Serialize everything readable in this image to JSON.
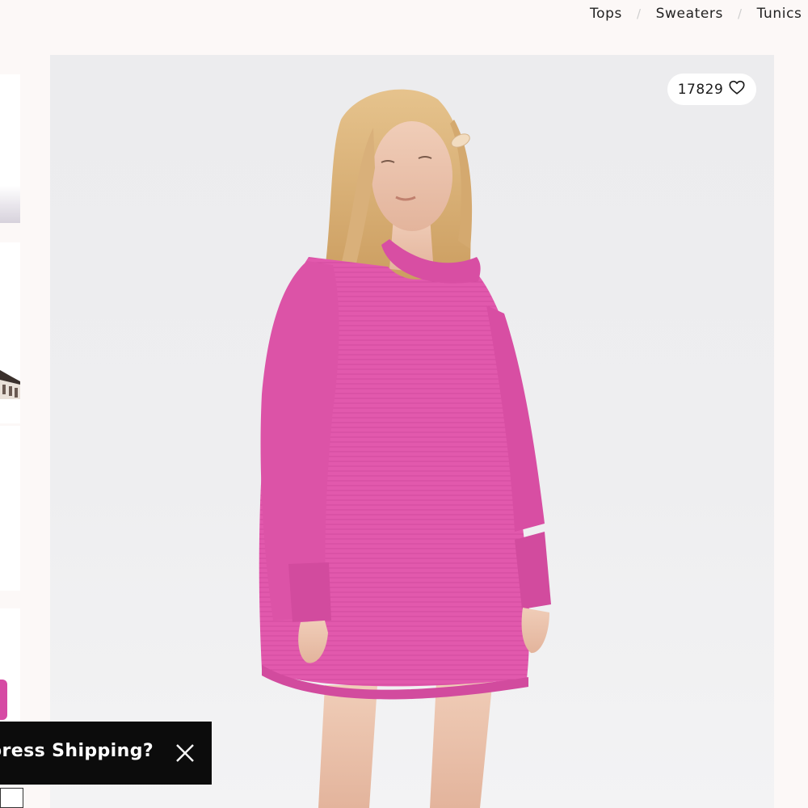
{
  "breadcrumb": {
    "items": [
      "Tops",
      "Sweaters",
      "Tunics"
    ],
    "separator": "/"
  },
  "product": {
    "like_count": "17829",
    "like_icon": "heart-outline-icon",
    "sweater_color": "#e259ad"
  },
  "promo": {
    "text": "press Shipping?",
    "close_icon": "close-icon"
  }
}
